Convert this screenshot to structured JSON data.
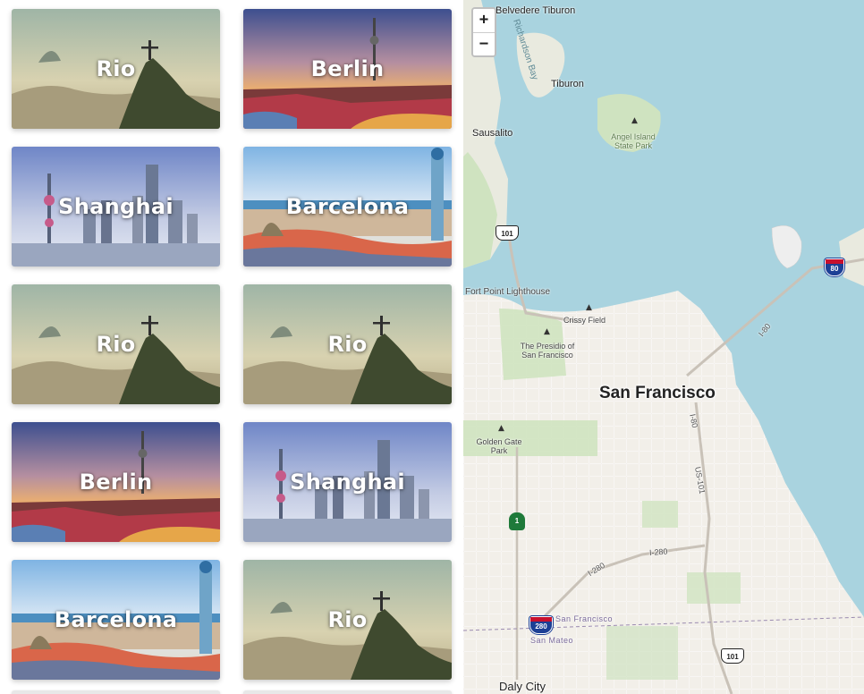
{
  "cities": [
    {
      "name": "Rio",
      "scene": "rio"
    },
    {
      "name": "Berlin",
      "scene": "berlin"
    },
    {
      "name": "Shanghai",
      "scene": "shanghai"
    },
    {
      "name": "Barcelona",
      "scene": "barcelona"
    },
    {
      "name": "Rio",
      "scene": "rio"
    },
    {
      "name": "Rio",
      "scene": "rio"
    },
    {
      "name": "Berlin",
      "scene": "berlin"
    },
    {
      "name": "Shanghai",
      "scene": "shanghai"
    },
    {
      "name": "Barcelona",
      "scene": "barcelona"
    },
    {
      "name": "Rio",
      "scene": "rio"
    }
  ],
  "map": {
    "zoom_in": "+",
    "zoom_out": "−",
    "labels": {
      "belvedere_tiburon": "Belvedere Tiburon",
      "tiburon": "Tiburon",
      "richardson_bay": "Richardson Bay",
      "sausalito": "Sausalito",
      "angel_island": "Angel Island State Park",
      "fort_point": "Fort Point Lighthouse",
      "crissy_field": "Crissy Field",
      "presidio": "The Presidio of San Francisco",
      "san_francisco": "San Francisco",
      "golden_gate_park": "Golden Gate Park",
      "daly_city": "Daly City",
      "south_sf": "San Francisco",
      "san_mateo": "San Mateo",
      "i80_label": "I-80",
      "i80_south": "I-80",
      "us101_label": "US-101",
      "i280_a": "I-280",
      "i280_b": "I-280"
    },
    "shields": {
      "us101_north": "101",
      "us101_south": "101",
      "i80": "80",
      "i280": "280",
      "ca1": "1"
    },
    "colors": {
      "water": "#a9d3df",
      "land": "#f2efe9",
      "park": "#cfe3c0",
      "street": "#ffffff",
      "freeway": "#c9c2b8"
    }
  }
}
